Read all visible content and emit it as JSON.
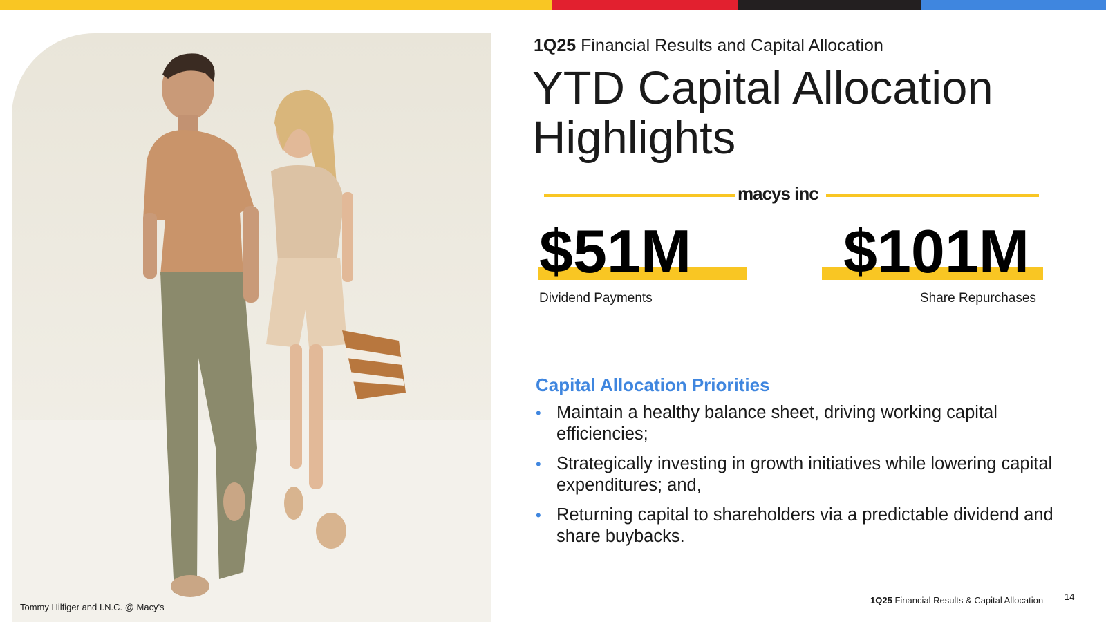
{
  "colors": {
    "yellow": "#f9c623",
    "red": "#e2202f",
    "dark": "#231f20",
    "blue": "#3f86df",
    "accent_text": "#3f86df"
  },
  "header": {
    "kicker_bold": "1Q25",
    "kicker_rest": "Financial Results and Capital Allocation",
    "title": "YTD Capital Allocation Highlights"
  },
  "photo": {
    "credit": "Tommy Hilfiger and I.N.C. @ Macy's"
  },
  "brand": {
    "name": "macys inc"
  },
  "metrics": [
    {
      "value": "$51M",
      "label": "Dividend Payments"
    },
    {
      "value": "$101M",
      "label": "Share Repurchases"
    }
  ],
  "priorities": {
    "heading": "Capital Allocation Priorities",
    "items": [
      "Maintain a healthy balance sheet, driving working capital efficiencies;",
      "Strategically investing in growth initiatives while lowering capital expenditures; and,",
      "Returning capital to shareholders via a predictable dividend and share buybacks."
    ]
  },
  "footer": {
    "bold": "1Q25",
    "rest": "Financial Results & Capital Allocation",
    "page": "14"
  }
}
